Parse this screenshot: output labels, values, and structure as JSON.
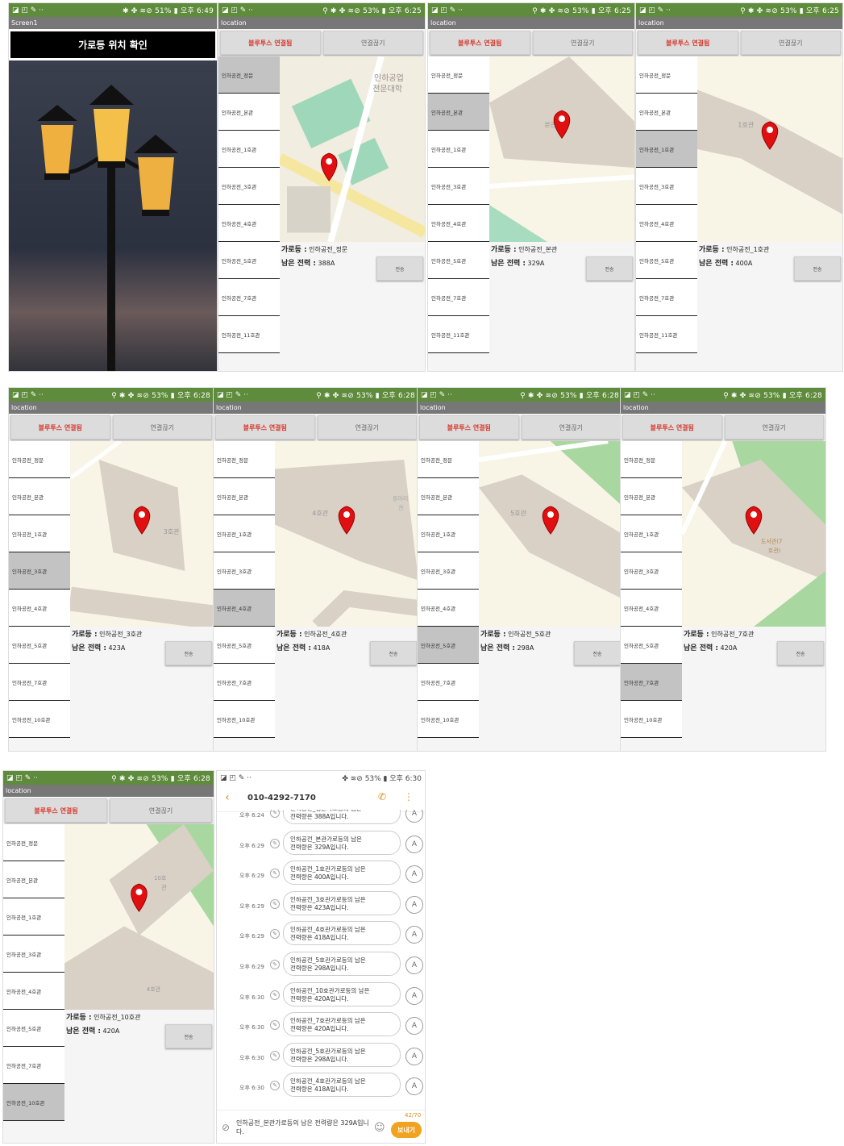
{
  "status": {
    "icons_left": "◪ ◰ ✎ ··",
    "s1_right": "✱ ✤ ≋⊘ 51% ▮ 오후 6:49",
    "s2_right": "⚲ ✱ ✤ ≋⊘ 53% ▮ 오후 6:25",
    "s3_right": "⚲ ✱ ✤ ≋⊘ 53% ▮ 오후 6:28",
    "s4_right": "✤ ≋⊘ 53% ▮ 오후 6:30"
  },
  "screen1": {
    "title": "Screen1",
    "header": "가로등 위치 확인"
  },
  "app": {
    "title": "location",
    "bt_connected": "블루투스 연결됨",
    "disconnect": "연결끊기",
    "send": "전송",
    "label_lamp": "가로등 :",
    "label_power": "남은 전력 :"
  },
  "lists": {
    "a": [
      "인하공전_정문",
      "인하공전_본관",
      "인하공전_1호관",
      "인하공전_3호관",
      "인하공전_4호관",
      "인하공전_5호관",
      "인하공전_7호관",
      "인하공전_11호관"
    ],
    "b": [
      "인하공전_정문",
      "인하공전_본관",
      "인하공전_1호관",
      "인하공전_3호관",
      "인하공전_4호관",
      "인하공전_5호관",
      "인하공전_7호관",
      "인하공전_10호관"
    ]
  },
  "screens": [
    {
      "lamp": "인하공전_정문",
      "power": "388A"
    },
    {
      "lamp": "인하공전_본관",
      "power": "329A"
    },
    {
      "lamp": "인하공전_1호관",
      "power": "400A"
    },
    {
      "lamp": "인하공전_3호관",
      "power": "423A"
    },
    {
      "lamp": "인하공전_4호관",
      "power": "418A"
    },
    {
      "lamp": "인하공전_5호관",
      "power": "298A"
    },
    {
      "lamp": "인하공전_7호관",
      "power": "420A"
    },
    {
      "lamp": "인하공전_10호관",
      "power": "420A"
    }
  ],
  "maplabels": {
    "m1_school": "인하공업",
    "m1_school2": "전문대학",
    "m2": "본관",
    "m3": "1호관",
    "m4": "3호관",
    "m5": "4호관",
    "m5b": "동아리",
    "m5c": "관",
    "m6": "5호관",
    "m7": "도서관(7",
    "m7b": "호관)",
    "m8": "10호",
    "m8b": "관",
    "m8c": "4호관"
  },
  "chat": {
    "phone": "010-4292-7170",
    "counter": "42/70",
    "input": "인하공전_본관가로등의 남은 전력량은 329A입니다.",
    "send": "보내기",
    "tr": "A",
    "messages": [
      {
        "time": "오후 6:24",
        "l1": "인하공전_정문가로등의 남은",
        "l2": "전력량은 388A입니다."
      },
      {
        "time": "오후 6:29",
        "l1": "인하공전_본관가로등의 남은",
        "l2": "전력량은 329A입니다."
      },
      {
        "time": "오후 6:29",
        "l1": "인하공전_1호관가로등의 남은",
        "l2": "전력량은 400A입니다."
      },
      {
        "time": "오후 6:29",
        "l1": "인하공전_3호관가로등의 남은",
        "l2": "전력량은 423A입니다."
      },
      {
        "time": "오후 6:29",
        "l1": "인하공전_4호관가로등의 남은",
        "l2": "전력량은 418A입니다."
      },
      {
        "time": "오후 6:29",
        "l1": "인하공전_5호관가로등의 남은",
        "l2": "전력량은 298A입니다."
      },
      {
        "time": "오후 6:30",
        "l1": "인하공전_10호관가로등의 남은",
        "l2": "전력량은 420A입니다."
      },
      {
        "time": "오후 6:30",
        "l1": "인하공전_7호관가로등의 남은",
        "l2": "전력량은 420A입니다."
      },
      {
        "time": "오후 6:30",
        "l1": "인하공전_5호관가로등의 남은",
        "l2": "전력량은 298A입니다."
      },
      {
        "time": "오후 6:30",
        "l1": "인하공전_4호관가로등의 남은",
        "l2": "전력량은 418A입니다."
      }
    ]
  }
}
